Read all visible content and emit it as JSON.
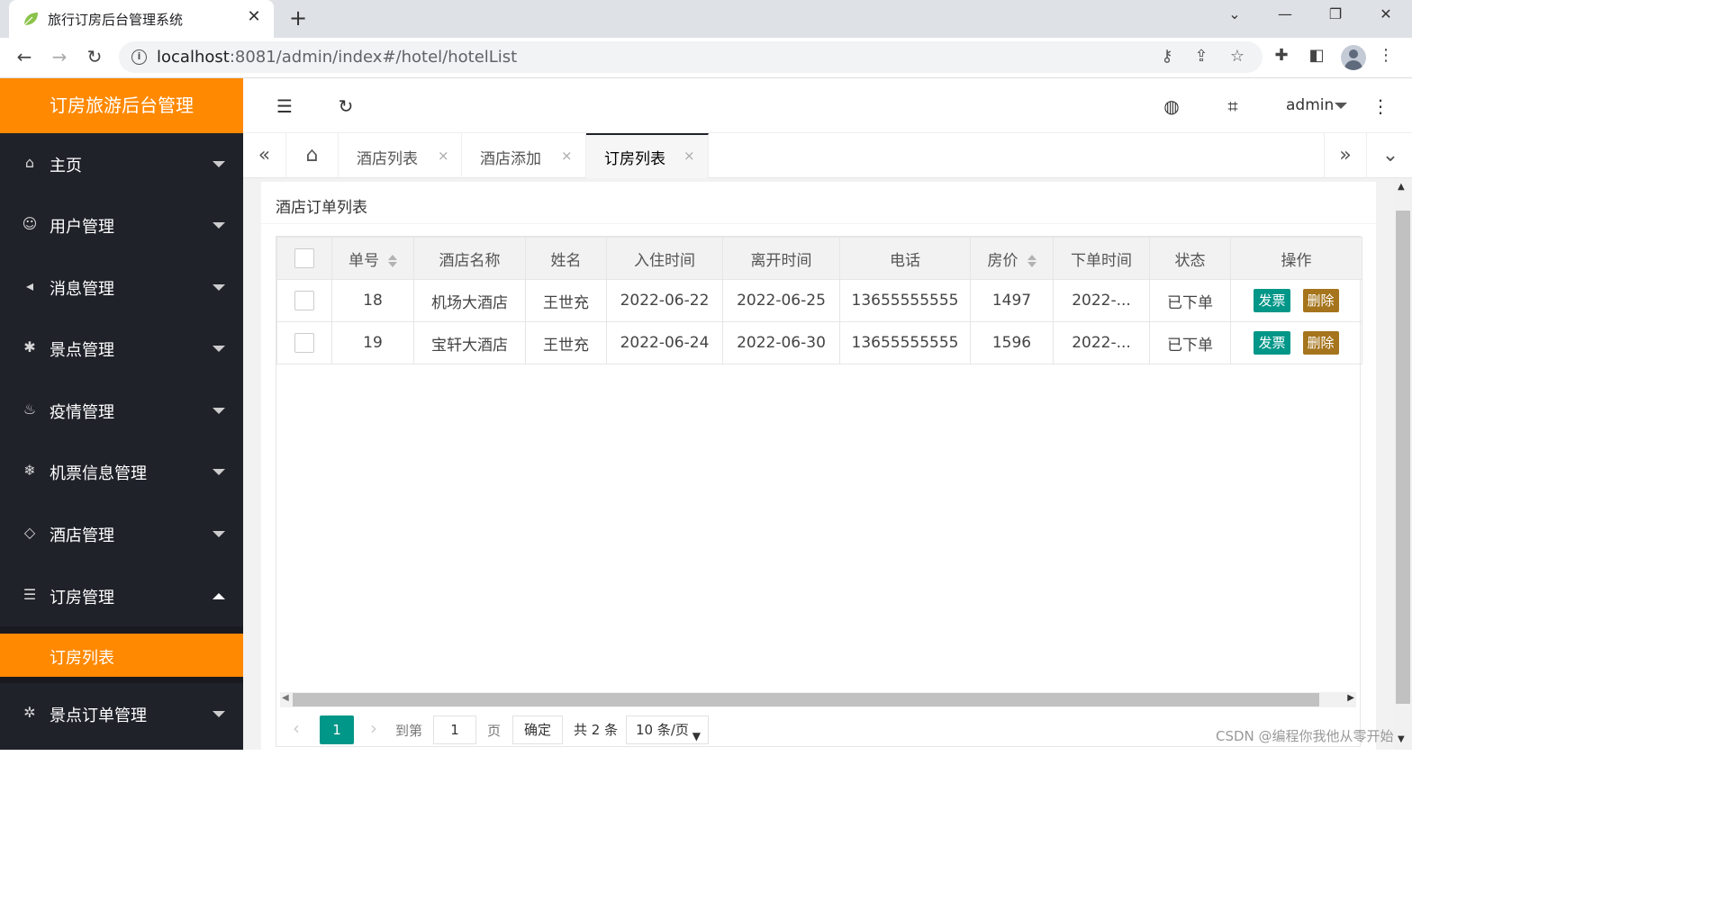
{
  "browser": {
    "tab_title": "旅行订房后台管理系统",
    "tab_close": "✕",
    "new_tab": "+",
    "url_host": "localhost",
    "url_rest": ":8081/admin/index#/hotel/hotelList",
    "back": "←",
    "forward": "→",
    "reload": "↻",
    "minimize": "—",
    "restore": "❐",
    "close": "✕",
    "tabs_menu": "⌄"
  },
  "app": {
    "brand": "订房旅游后台管理",
    "admin_name": "admin"
  },
  "sidebar": {
    "items": [
      {
        "label": "主页",
        "icon": "⌂"
      },
      {
        "label": "用户管理",
        "icon": "☺"
      },
      {
        "label": "消息管理",
        "icon": "◂"
      },
      {
        "label": "景点管理",
        "icon": "✱"
      },
      {
        "label": "疫情管理",
        "icon": "♨"
      },
      {
        "label": "机票信息管理",
        "icon": "❄"
      },
      {
        "label": "酒店管理",
        "icon": "◇"
      },
      {
        "label": "订房管理",
        "icon": "☰"
      },
      {
        "label": "景点订单管理",
        "icon": "✲"
      }
    ],
    "active_sub": "订房列表"
  },
  "tabs": {
    "left_arrow": "«",
    "right_arrow": "»",
    "menu_arrow": "⌄",
    "home_icon": "⌂",
    "items": [
      {
        "label": "酒店列表"
      },
      {
        "label": "酒店添加"
      },
      {
        "label": "订房列表"
      }
    ],
    "close_glyph": "×"
  },
  "main": {
    "card_title": "酒店订单列表",
    "columns": [
      "单号",
      "酒店名称",
      "姓名",
      "入住时间",
      "离开时间",
      "电话",
      "房价",
      "下单时间",
      "状态",
      "操作"
    ],
    "rows": [
      {
        "id": "18",
        "hotel": "机场大酒店",
        "name": "王世充",
        "checkin": "2022-06-22",
        "checkout": "2022-06-25",
        "phone": "13655555555",
        "price": "1497",
        "order_time": "2022-...",
        "status": "已下单",
        "invoice": "发票",
        "delete": "删除"
      },
      {
        "id": "19",
        "hotel": "宝轩大酒店",
        "name": "王世充",
        "checkin": "2022-06-24",
        "checkout": "2022-06-30",
        "phone": "13655555555",
        "price": "1596",
        "order_time": "2022-...",
        "status": "已下单",
        "invoice": "发票",
        "delete": "删除"
      }
    ]
  },
  "pagination": {
    "prev": "‹",
    "next": "›",
    "current": "1",
    "goto_label": "到第",
    "goto_value": "1",
    "page_label": "页",
    "confirm": "确定",
    "total": "共 2 条",
    "page_size": "10 条/页"
  },
  "watermark": "CSDN @编程你我他从零开始",
  "colors": {
    "accent": "#ff8900",
    "sidebar": "#20222a",
    "invoice_btn": "#009688",
    "delete_btn": "#a5741c"
  }
}
